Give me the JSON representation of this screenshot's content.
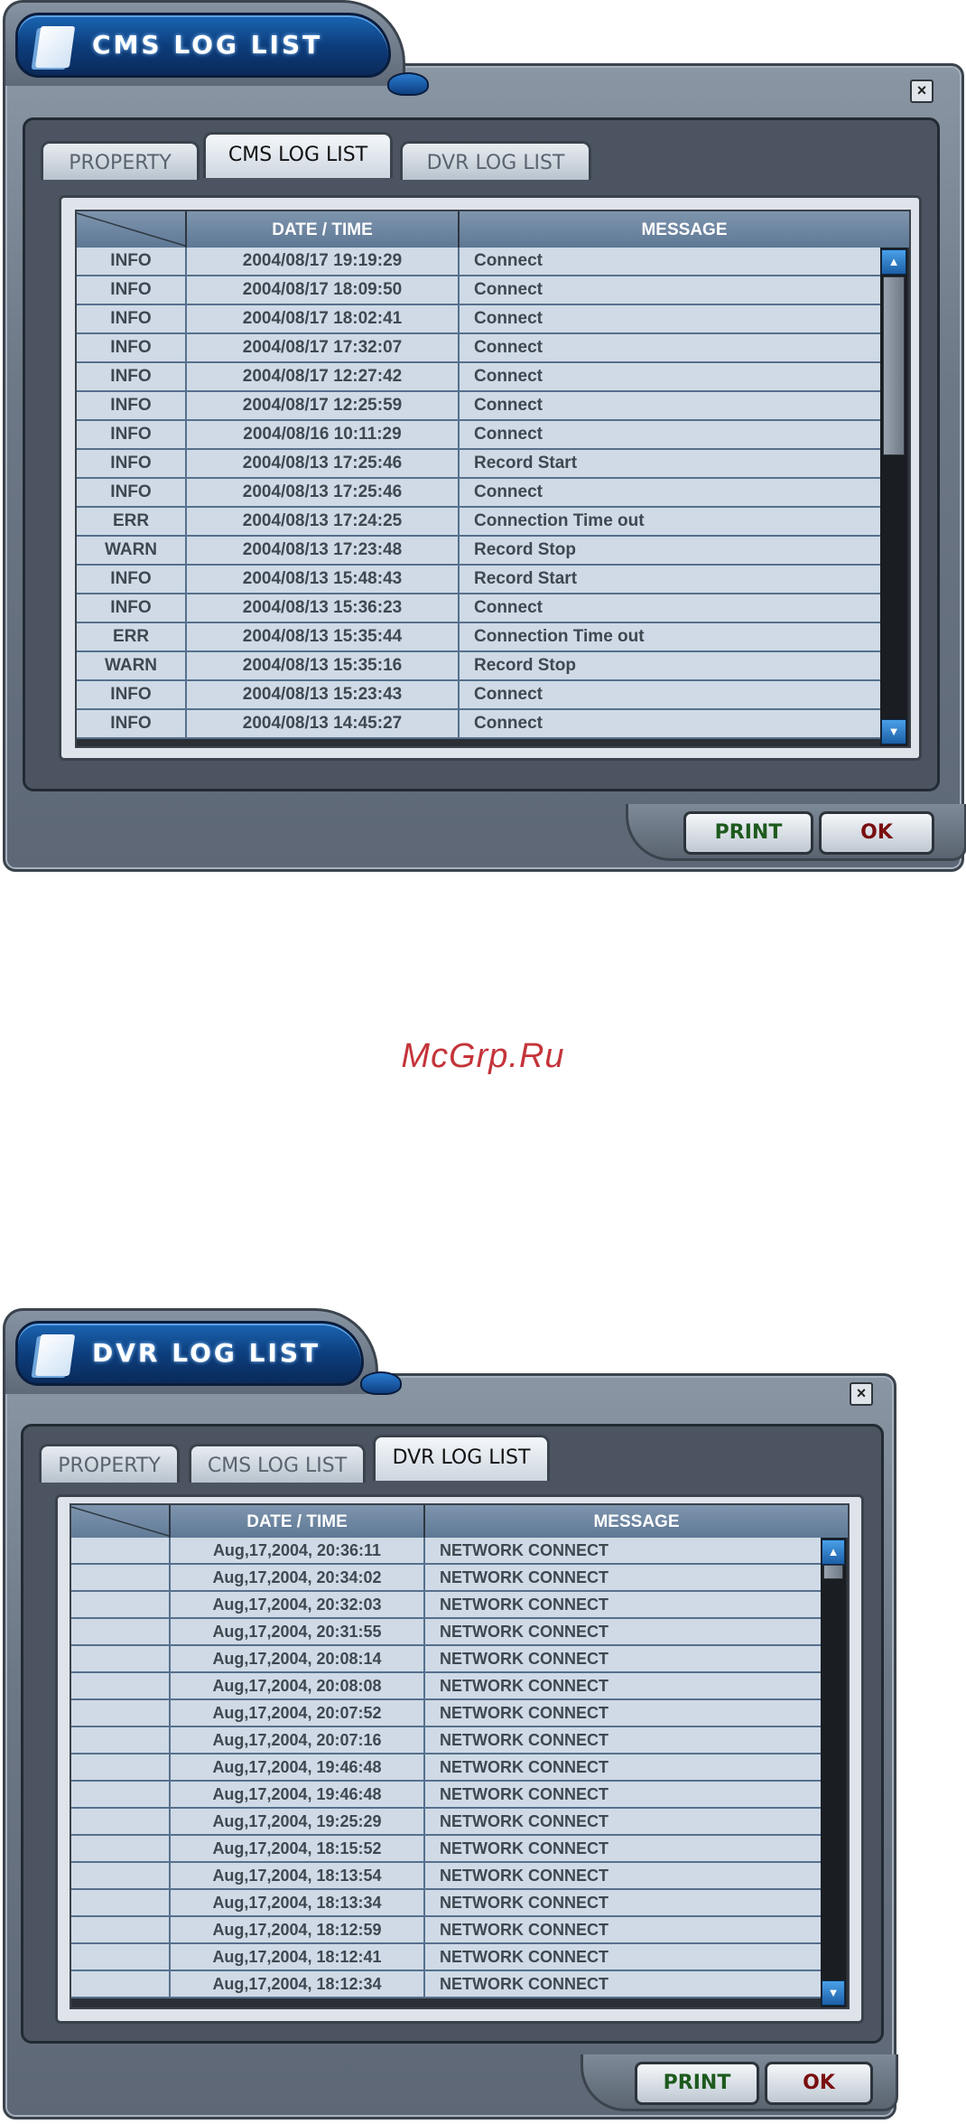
{
  "watermark": "McGrp.Ru",
  "cms_window": {
    "title": "CMS LOG LIST",
    "close": "×",
    "tabs": [
      "PROPERTY",
      "CMS LOG LIST",
      "DVR LOG LIST"
    ],
    "columns": [
      "",
      "DATE / TIME",
      "MESSAGE"
    ],
    "rows": [
      [
        "INFO",
        "2004/08/17 19:19:29",
        "Connect"
      ],
      [
        "INFO",
        "2004/08/17 18:09:50",
        "Connect"
      ],
      [
        "INFO",
        "2004/08/17 18:02:41",
        "Connect"
      ],
      [
        "INFO",
        "2004/08/17 17:32:07",
        "Connect"
      ],
      [
        "INFO",
        "2004/08/17 12:27:42",
        "Connect"
      ],
      [
        "INFO",
        "2004/08/17 12:25:59",
        "Connect"
      ],
      [
        "INFO",
        "2004/08/16 10:11:29",
        "Connect"
      ],
      [
        "INFO",
        "2004/08/13 17:25:46",
        "Record Start"
      ],
      [
        "INFO",
        "2004/08/13 17:25:46",
        "Connect"
      ],
      [
        "ERR",
        "2004/08/13 17:24:25",
        "Connection Time out"
      ],
      [
        "WARN",
        "2004/08/13 17:23:48",
        "Record Stop"
      ],
      [
        "INFO",
        "2004/08/13 15:48:43",
        "Record Start"
      ],
      [
        "INFO",
        "2004/08/13 15:36:23",
        "Connect"
      ],
      [
        "ERR",
        "2004/08/13 15:35:44",
        "Connection Time out"
      ],
      [
        "WARN",
        "2004/08/13 15:35:16",
        "Record Stop"
      ],
      [
        "INFO",
        "2004/08/13 15:23:43",
        "Connect"
      ],
      [
        "INFO",
        "2004/08/13 14:45:27",
        "Connect"
      ]
    ],
    "buttons": {
      "print": "PRINT",
      "ok": "OK"
    }
  },
  "dvr_window": {
    "title": "DVR LOG LIST",
    "close": "×",
    "tabs": [
      "PROPERTY",
      "CMS LOG LIST",
      "DVR LOG LIST"
    ],
    "columns": [
      "",
      "DATE / TIME",
      "MESSAGE"
    ],
    "rows": [
      [
        "",
        "Aug,17,2004, 20:36:11",
        "NETWORK CONNECT"
      ],
      [
        "",
        "Aug,17,2004, 20:34:02",
        "NETWORK CONNECT"
      ],
      [
        "",
        "Aug,17,2004, 20:32:03",
        "NETWORK CONNECT"
      ],
      [
        "",
        "Aug,17,2004, 20:31:55",
        "NETWORK CONNECT"
      ],
      [
        "",
        "Aug,17,2004, 20:08:14",
        "NETWORK CONNECT"
      ],
      [
        "",
        "Aug,17,2004, 20:08:08",
        "NETWORK CONNECT"
      ],
      [
        "",
        "Aug,17,2004, 20:07:52",
        "NETWORK CONNECT"
      ],
      [
        "",
        "Aug,17,2004, 20:07:16",
        "NETWORK CONNECT"
      ],
      [
        "",
        "Aug,17,2004, 19:46:48",
        "NETWORK CONNECT"
      ],
      [
        "",
        "Aug,17,2004, 19:46:48",
        "NETWORK CONNECT"
      ],
      [
        "",
        "Aug,17,2004, 19:25:29",
        "NETWORK CONNECT"
      ],
      [
        "",
        "Aug,17,2004, 18:15:52",
        "NETWORK CONNECT"
      ],
      [
        "",
        "Aug,17,2004, 18:13:54",
        "NETWORK CONNECT"
      ],
      [
        "",
        "Aug,17,2004, 18:13:34",
        "NETWORK CONNECT"
      ],
      [
        "",
        "Aug,17,2004, 18:12:59",
        "NETWORK CONNECT"
      ],
      [
        "",
        "Aug,17,2004, 18:12:41",
        "NETWORK CONNECT"
      ],
      [
        "",
        "Aug,17,2004, 18:12:34",
        "NETWORK CONNECT"
      ]
    ],
    "buttons": {
      "print": "PRINT",
      "ok": "OK"
    }
  }
}
